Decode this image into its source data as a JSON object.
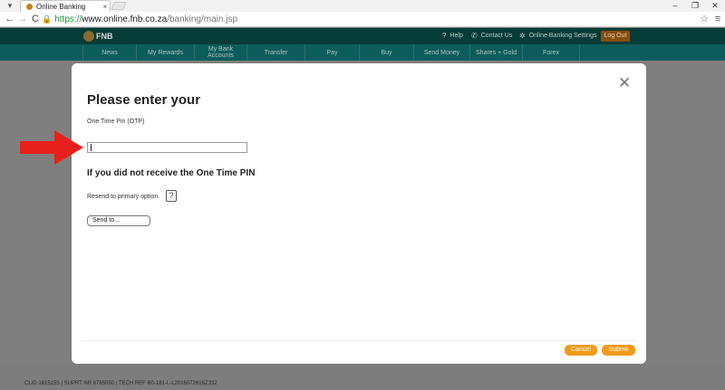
{
  "browser": {
    "menu_icon": "tab-menu-icon",
    "tab_title": "Online Banking",
    "tab_close": "×",
    "window_controls": {
      "minimize": "–",
      "restore": "❐",
      "close": "✕"
    },
    "nav": {
      "back": "←",
      "forward": "→",
      "reload": "C"
    },
    "url_scheme": "https://",
    "url_host": "www.online.fnb.co.za",
    "url_path": "/banking/main.jsp",
    "star": "☆",
    "menu": "≡"
  },
  "site": {
    "brand": "FNB",
    "top_links": [
      {
        "icon": "?",
        "label": "Help"
      },
      {
        "icon": "✆",
        "label": "Contact Us"
      },
      {
        "icon": "✲",
        "label": "Online Banking Settings"
      }
    ],
    "logout_label": "Log Out",
    "nav_items": [
      "News",
      "My Rewards",
      "My Bank Accounts",
      "Transfer",
      "Pay",
      "Buy",
      "Send Money",
      "Shares + Gold",
      "Forex"
    ],
    "footer_text": "CLID 1615155 | SUPRT NR 8785050 | TECH REF B0-181-L-L2016072616Z332"
  },
  "modal": {
    "title": "Please enter your",
    "otp_label": "One Time Pin (OTP)",
    "otp_value": "",
    "section_title": "If you did not receive the One Time PIN",
    "resend_label": "Resend to primary option.",
    "help_label": "?",
    "sendto_label": "Send to...",
    "close_label": "✕",
    "cancel_label": "Cancel",
    "submit_label": "Submit"
  },
  "colors": {
    "header_dark": "#063c37",
    "nav_teal": "#0d5c5c",
    "accent_orange": "#f29a1a",
    "arrow_red": "#e8201c"
  }
}
